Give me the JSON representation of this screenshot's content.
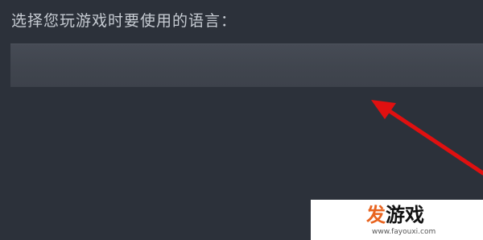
{
  "prompt_label": "选择您玩游戏时要使用的语言：",
  "language_select": {
    "value": ""
  },
  "watermark": {
    "logo_first_char": "发",
    "logo_rest": "游戏",
    "url": "www.fayouxi.com"
  },
  "colors": {
    "background": "#2c313a",
    "select_fill": "#42474f",
    "label_text": "#c6cbd2",
    "arrow": "#e01010",
    "watermark_accent": "#e8641f"
  }
}
